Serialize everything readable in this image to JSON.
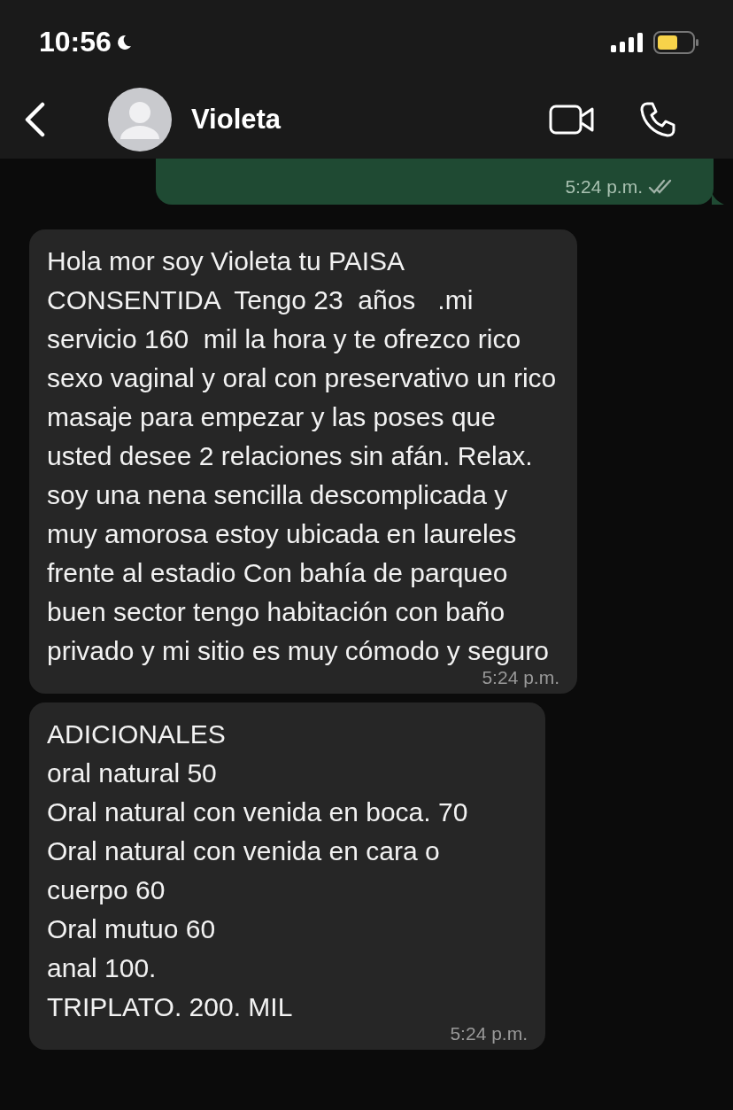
{
  "status_bar": {
    "time": "10:56"
  },
  "header": {
    "contact_name": "Violeta"
  },
  "messages": [
    {
      "kind": "outgoing",
      "time": "5:24 p.m."
    },
    {
      "kind": "incoming",
      "text": "Hola mor soy Violeta tu PAISA CONSENTIDA  Tengo 23  años   .mi servicio 160  mil la hora y te ofrezco rico sexo vaginal y oral con preservativo un rico masaje para empezar y las poses que usted desee 2 relaciones sin afán. Relax.    soy una nena sencilla descomplicada y muy amorosa estoy ubicada en laureles frente al estadio Con bahía de parqueo buen sector tengo habitación con baño privado y mi sitio es muy cómodo y seguro",
      "time": "5:24 p.m."
    },
    {
      "kind": "incoming",
      "lines": [
        "ADICIONALES",
        "oral natural 50",
        "Oral natural con venida en boca. 70",
        "Oral natural con venida en cara o cuerpo 60",
        "Oral mutuo 60",
        "anal 100.",
        "TRIPLATO. 200. MIL"
      ],
      "time": "5:24 p.m."
    }
  ]
}
